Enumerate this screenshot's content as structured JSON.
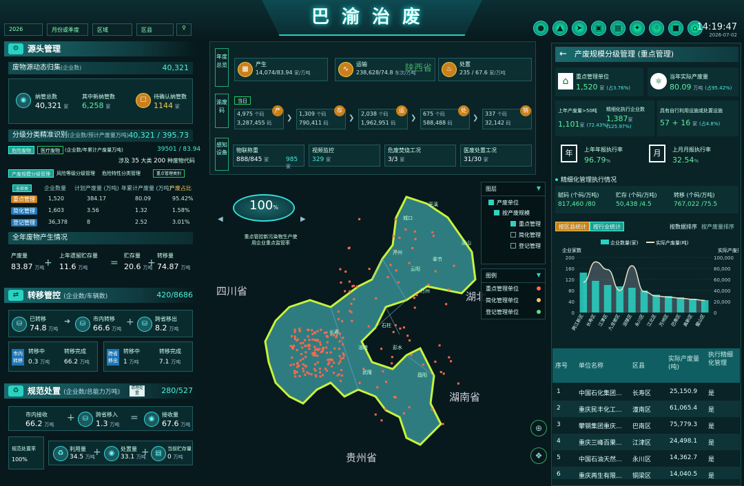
{
  "header": {
    "title": "巴渝治废",
    "time": "14:19:47",
    "date": "2026-07-02",
    "filters": [
      "2026",
      "月份或季度",
      "区域",
      "区县"
    ]
  },
  "source": {
    "title": "源头管理",
    "dyn_title": "废物源动态归集",
    "dyn_sub": "(企业数)",
    "dyn_value": "40,321",
    "k1_label": "纳管总数",
    "k1_value": "40,321",
    "k1_unit": "家",
    "k2_label": "其中新纳管数",
    "k2_value": "6,258",
    "k2_unit": "家",
    "k3_label": "待确认纳管数",
    "k3_value": "1144",
    "k3_unit": "家",
    "class_title": "分级分类精准识别",
    "class_sub": "(企业数/预计产废量万吨)",
    "class_value": "40,321 / 395.73",
    "tab1": "危险废物",
    "tab2": "医疗废物",
    "tab_desc": "(企业数/年累计产废量万吨)",
    "tab_value": "39501 / 83.94",
    "involve": "涉及",
    "involve_n1": "35",
    "involve_u1": "大类",
    "involve_n2": "200",
    "involve_u2": "种废物代码",
    "sub_tabs": [
      "产废规模分级管理",
      "风险等级分级管理",
      "危险特性分类管理"
    ],
    "sub_dropdown": "重点管理类别",
    "table_head": [
      "企业数量",
      "计划产废量 (万吨)",
      "年累计产废量 (万吨)",
      "产废占比"
    ],
    "table_all": "全部类",
    "rows": [
      {
        "name": "重点管理",
        "c1": "1,520",
        "c2": "384.17",
        "c3": "80.09",
        "c4": "95.42%"
      },
      {
        "name": "简化管理",
        "c1": "1,603",
        "c2": "3.56",
        "c3": "1.32",
        "c4": "1.58%"
      },
      {
        "name": "登记管理",
        "c1": "36,378",
        "c2": "8",
        "c3": "2.52",
        "c4": "3.01%"
      }
    ],
    "year_title": "全年废物产生情况",
    "y1_label": "产废量",
    "y1_value": "83.87",
    "y1_unit": "万吨",
    "y2_label": "上年遗留贮存量",
    "y2_value": "11.6",
    "y2_unit": "万吨",
    "y3_label": "贮存量",
    "y3_value": "20.6",
    "y3_unit": "万吨",
    "y4_label": "转移量",
    "y4_value": "74.87",
    "y4_unit": "万吨"
  },
  "transfer": {
    "title": "转移管控",
    "sub": "(企业数/车辆数)",
    "value": "420/8686",
    "t1_label": "已转移",
    "t1_value": "74.8",
    "t1_unit": "万吨",
    "t2_label": "市内转移",
    "t2_value": "66.6",
    "t2_unit": "万吨",
    "t3_label": "跨省移出",
    "t3_value": "8.2",
    "t3_unit": "万吨",
    "g1_tag": "市内转移",
    "g1a_label": "转移中",
    "g1a_value": "0.3",
    "g1a_unit": "万吨",
    "g1b_label": "转移完成",
    "g1b_value": "66.2",
    "g1b_unit": "万吨",
    "g2_tag": "跨省移出",
    "g2a_label": "转移中",
    "g2a_value": "1",
    "g2a_unit": "万吨",
    "g2b_label": "转移完成",
    "g2b_value": "7.1",
    "g2b_unit": "万吨"
  },
  "disposal": {
    "title": "规范处置",
    "sub": "(企业数/总能力万吨)",
    "badge": "请理处置",
    "value": "280/527",
    "d1_label": "市内接收",
    "d1_value": "66.2",
    "d1_unit": "万吨",
    "d2_label": "跨省移入",
    "d2_value": "1.3",
    "d2_unit": "万吨",
    "d3_label": "接收量",
    "d3_value": "67.6",
    "d3_unit": "万吨",
    "rate_label": "规范处置率",
    "rate_value": "100%",
    "e1_label": "利用量",
    "e1_value": "34.5",
    "e1_unit": "万吨",
    "e2_label": "处置量",
    "e2_value": "33.1",
    "e2_unit": "万吨",
    "e3_label": "当前贮存量",
    "e3_value": "0",
    "e3_unit": "万吨"
  },
  "overview": {
    "year_total": "年度总览",
    "produce_label": "产生",
    "produce_value": "14,074/83.94",
    "produce_unit": "家/万吨",
    "transport_label": "运输",
    "transport_value": "238,628/74.8",
    "transport_unit": "车次/万吨",
    "dispose_label": "处置",
    "dispose_value": "235 / 67.6",
    "dispose_unit": "家/万吨",
    "code_label": "渝废码",
    "today": "当日",
    "codes": [
      {
        "a": "4,975",
        "au": "个码",
        "b": "3,287,455",
        "bu": "码",
        "tag": "产"
      },
      {
        "a": "1,309",
        "au": "个码",
        "b": "790,411",
        "bu": "码",
        "tag": "存"
      },
      {
        "a": "2,038",
        "au": "个码",
        "b": "1,962,951",
        "bu": "码",
        "tag": "运"
      },
      {
        "a": "675",
        "au": "个码",
        "b": "588,488",
        "bu": "码",
        "tag": "处"
      },
      {
        "a": "337",
        "au": "个码",
        "b": "32,142",
        "bu": "码",
        "tag": "销"
      }
    ],
    "sense_label": "感知设备",
    "s1_label": "物联称重",
    "s1_value": "888/845",
    "s1_unit": "家",
    "s1_extra": "985",
    "s1_extra_unit": "家",
    "s2_label": "视频监控",
    "s2_value": "329",
    "s2_unit": "家",
    "s3_label": "危废焚烧工况",
    "s3_value": "3/3",
    "s3_unit": "家",
    "s4_label": "医废处置工况",
    "s4_value": "31/30",
    "s4_unit": "家"
  },
  "map": {
    "gauge_value": "100",
    "gauge_unit": "%",
    "gauge_caption_1": "重点管控新污染物生产使",
    "gauge_caption_2": "用企业重点监管率",
    "prov_sichuan": "四川省",
    "prov_hubei": "湖北",
    "prov_hunan": "湖南省",
    "prov_guizhou": "贵州省",
    "prov_shaanxi": "陕西省",
    "districts": [
      "城口",
      "巫溪",
      "开州",
      "云阳",
      "奉节",
      "巫山",
      "万州",
      "石柱",
      "长寿",
      "涪陵",
      "武隆",
      "彭水",
      "酉阳"
    ],
    "layers_title": "图层",
    "layer_1": "产废单位",
    "layer_2": "按产废规模",
    "layer_3": "重点管理",
    "layer_4": "简化管理",
    "layer_5": "登记管理",
    "legend_title": "图例",
    "legend_1": "重点管理单位",
    "legend_2": "简化管理单位",
    "legend_3": "登记管理单位",
    "colors": {
      "key": "#ff6a4d",
      "simple": "#f5c851",
      "register": "#5fe07a",
      "map": "#2f7c80",
      "border": "#c9f23a"
    }
  },
  "right": {
    "title": "产废规模分级管理 (重点管理)",
    "r1_label": "重点管理单位",
    "r1_value": "1,520",
    "r1_unit": "家",
    "r1_pct": "(占3.76%)",
    "r2_label": "当年实际产废量",
    "r2_value": "80.09",
    "r2_unit": "万吨",
    "r2_pct": "(占95.42%)",
    "r3_label": "上年产废量>50吨",
    "r3_value": "1,101",
    "r3_unit": "家",
    "r3_pct": "(72.43%)",
    "r4_label": "精细化执行企业数",
    "r4_value": "1,387",
    "r4_unit": "家",
    "r4_pct": "(125.97%)",
    "r5_label": "具有自行利用设施或处置设施",
    "r5_value": "57 + 16",
    "r5_unit": "家",
    "r5_pct": "(占4.8%)",
    "r6_label": "上年年报执行率",
    "r6_value": "96.79",
    "r6_unit": "%",
    "r6_icon": "年",
    "r7_label": "上月月报执行率",
    "r7_value": "32.54",
    "r7_unit": "%",
    "r7_icon": "月",
    "fine_title": "精细化管理执行情况",
    "f1_label": "赋码 (个码/万吨)",
    "f1_value": "817,460 /80",
    "f2_label": "贮存 (个码/万吨)",
    "f2_value": "50,438 /4.5",
    "f3_label": "转移 (个码/万吨)",
    "f3_value": "767,022 /75.5",
    "btn_district": "按区县统计",
    "btn_industry": "按行业统计",
    "sort_data": "按数据排序",
    "sort_amount": "按产废量排序",
    "table_head": [
      "序号",
      "单位名称",
      "区县",
      "实际产废量(吨)",
      "执行精细化管理"
    ],
    "table": [
      {
        "n": "1",
        "name": "中国石化集团...",
        "dist": "长寿区",
        "amt": "25,150.9",
        "ok": "是"
      },
      {
        "n": "2",
        "name": "重庆民丰化工...",
        "dist": "潼南区",
        "amt": "61,065.4",
        "ok": "是"
      },
      {
        "n": "3",
        "name": "攀钢集团重庆...",
        "dist": "巴南区",
        "amt": "75,779.3",
        "ok": "是"
      },
      {
        "n": "4",
        "name": "重庆三峰百果...",
        "dist": "江津区",
        "amt": "24,498.1",
        "ok": "是"
      },
      {
        "n": "5",
        "name": "中国石油天然...",
        "dist": "永川区",
        "amt": "14,362.7",
        "ok": "是"
      },
      {
        "n": "6",
        "name": "重庆再生有限...",
        "dist": "铜梁区",
        "amt": "14,040.5",
        "ok": "是"
      }
    ]
  },
  "chart_data": {
    "type": "bar",
    "categories": [
      "两江新区",
      "长寿区",
      "江津区",
      "九龙坡区",
      "涪陵区",
      "永川区",
      "江北区",
      "万州区",
      "巴南区",
      "高新区",
      "璧山区"
    ],
    "series": [
      {
        "name": "企业数量(家)",
        "values": [
          145,
          115,
          100,
          95,
          90,
          80,
          65,
          60,
          55,
          50,
          45
        ]
      },
      {
        "name": "实际产废量(吨)",
        "values": [
          55000,
          92000,
          78000,
          40000,
          85000,
          38000,
          30000,
          28000,
          26000,
          24000,
          22000
        ]
      }
    ],
    "ylabel_left": "企业家数",
    "ylabel_right": "实际产废量",
    "ylim_left": [
      0,
      200
    ],
    "ylim_right": [
      0,
      100000
    ],
    "yticks_left": [
      "200",
      "160",
      "120",
      "80",
      "40",
      "0"
    ],
    "yticks_right": [
      "100,000",
      "80,000",
      "60,000",
      "40,000",
      "20,000",
      "0"
    ]
  }
}
